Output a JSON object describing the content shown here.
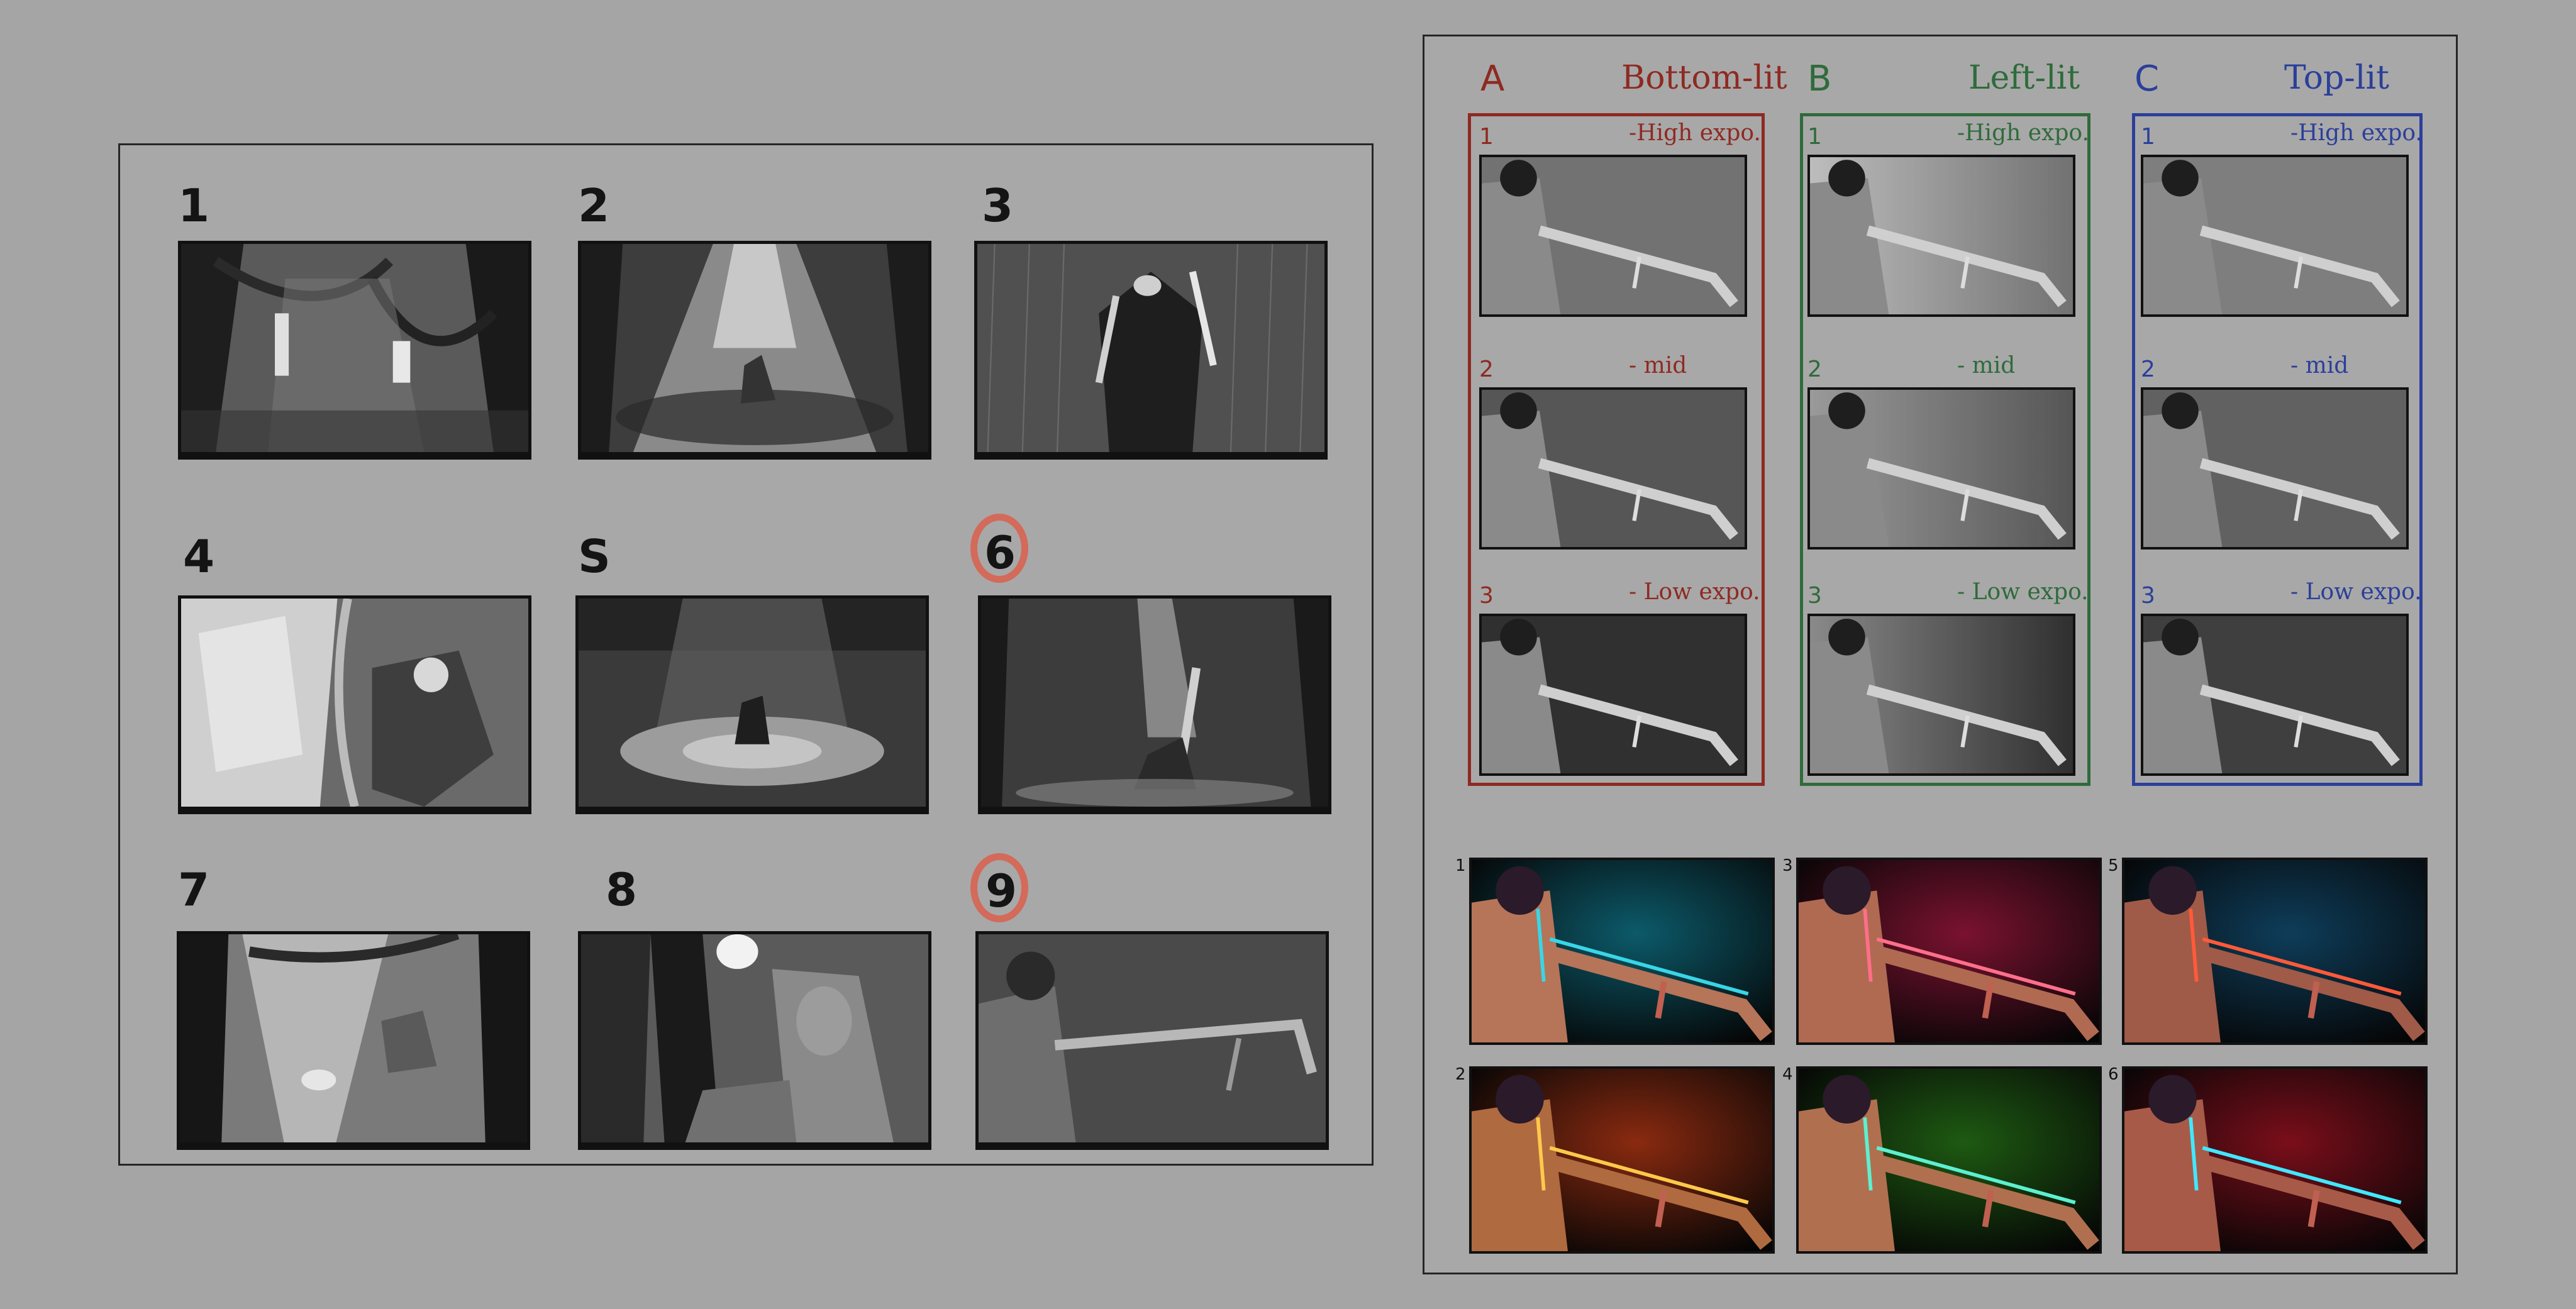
{
  "thumbnails": [
    {
      "number": "1",
      "tone": "dark-forest-two-figures",
      "circled": false
    },
    {
      "number": "2",
      "tone": "spotlight-stage-figure",
      "circled": false
    },
    {
      "number": "3",
      "tone": "rain-cloaked-figure",
      "circled": false
    },
    {
      "number": "4",
      "tone": "closeup-bright-left",
      "circled": false
    },
    {
      "number": "S",
      "tone": "forest-glow-figure",
      "circled": false
    },
    {
      "number": "6",
      "tone": "sword-in-ground",
      "circled": true
    },
    {
      "number": "7",
      "tone": "curtain-figure-crouch",
      "circled": false
    },
    {
      "number": "8",
      "tone": "portrait-closeup",
      "circled": false
    },
    {
      "number": "9",
      "tone": "figure-pointing-sword",
      "circled": true
    }
  ],
  "lighting_columns": [
    {
      "letter": "A",
      "title": "Bottom-lit",
      "color": "#8e2a22",
      "rows": [
        {
          "num": "1",
          "label": "-High expo."
        },
        {
          "num": "2",
          "label": "- mid"
        },
        {
          "num": "3",
          "label": "- Low expo."
        }
      ]
    },
    {
      "letter": "B",
      "title": "Left-lit",
      "color": "#2f6b3b",
      "rows": [
        {
          "num": "1",
          "label": "-High expo."
        },
        {
          "num": "2",
          "label": "- mid"
        },
        {
          "num": "3",
          "label": "- Low expo."
        }
      ]
    },
    {
      "letter": "C",
      "title": "Top-lit",
      "color": "#2b3f9a",
      "rows": [
        {
          "num": "1",
          "label": "-High expo."
        },
        {
          "num": "2",
          "label": "- mid"
        },
        {
          "num": "3",
          "label": "- Low expo."
        }
      ]
    }
  ],
  "color_variants": [
    {
      "number": "1",
      "bg": "#0c5a6a",
      "accent": "#38d6e6",
      "figure": "#b67458"
    },
    {
      "number": "3",
      "bg": "#7a1230",
      "accent": "#ff6f8a",
      "figure": "#b06a52"
    },
    {
      "number": "5",
      "bg": "#0e3d5a",
      "accent": "#ff5a3a",
      "figure": "#a05a48"
    },
    {
      "number": "2",
      "bg": "#8a2a10",
      "accent": "#ffc94a",
      "figure": "#b06a40"
    },
    {
      "number": "4",
      "bg": "#1e5a12",
      "accent": "#5cf0d0",
      "figure": "#b07050"
    },
    {
      "number": "6",
      "bg": "#7a0e1a",
      "accent": "#40e8ff",
      "figure": "#a85a48"
    }
  ],
  "colors": {
    "circle": "#d36a5a",
    "border": "#111111",
    "background": "#a5a5a5"
  }
}
